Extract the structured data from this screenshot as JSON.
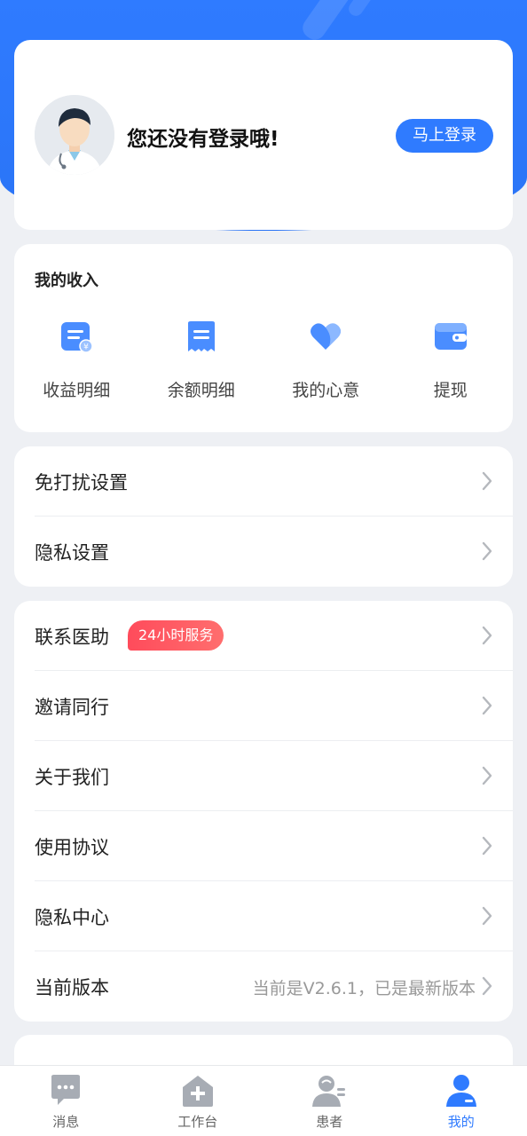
{
  "profile": {
    "login_prompt": "您还没有登录哦!",
    "login_button": "马上登录"
  },
  "income": {
    "title": "我的收入",
    "items": [
      {
        "label": "收益明细",
        "icon": "income-detail-icon"
      },
      {
        "label": "余额明细",
        "icon": "balance-detail-icon"
      },
      {
        "label": "我的心意",
        "icon": "heart-icon"
      },
      {
        "label": "提现",
        "icon": "wallet-icon"
      }
    ]
  },
  "settings": {
    "items": [
      "免打扰设置",
      "隐私设置"
    ]
  },
  "contact": {
    "items": [
      "联系医助",
      "邀请同行",
      "关于我们",
      "使用协议",
      "隐私中心",
      "当前版本"
    ],
    "badge": "24小时服务",
    "version_value": "当前是V2.6.1，已是最新版本"
  },
  "tabbar": {
    "tabs": [
      {
        "label": "消息",
        "icon": "message-icon"
      },
      {
        "label": "工作台",
        "icon": "workbench-icon"
      },
      {
        "label": "患者",
        "icon": "patient-icon"
      },
      {
        "label": "我的",
        "icon": "profile-icon"
      }
    ],
    "active_index": 3
  },
  "colors": {
    "primary": "#2f7bff",
    "badge": "#ff4b5b",
    "background": "#eef0f4"
  }
}
